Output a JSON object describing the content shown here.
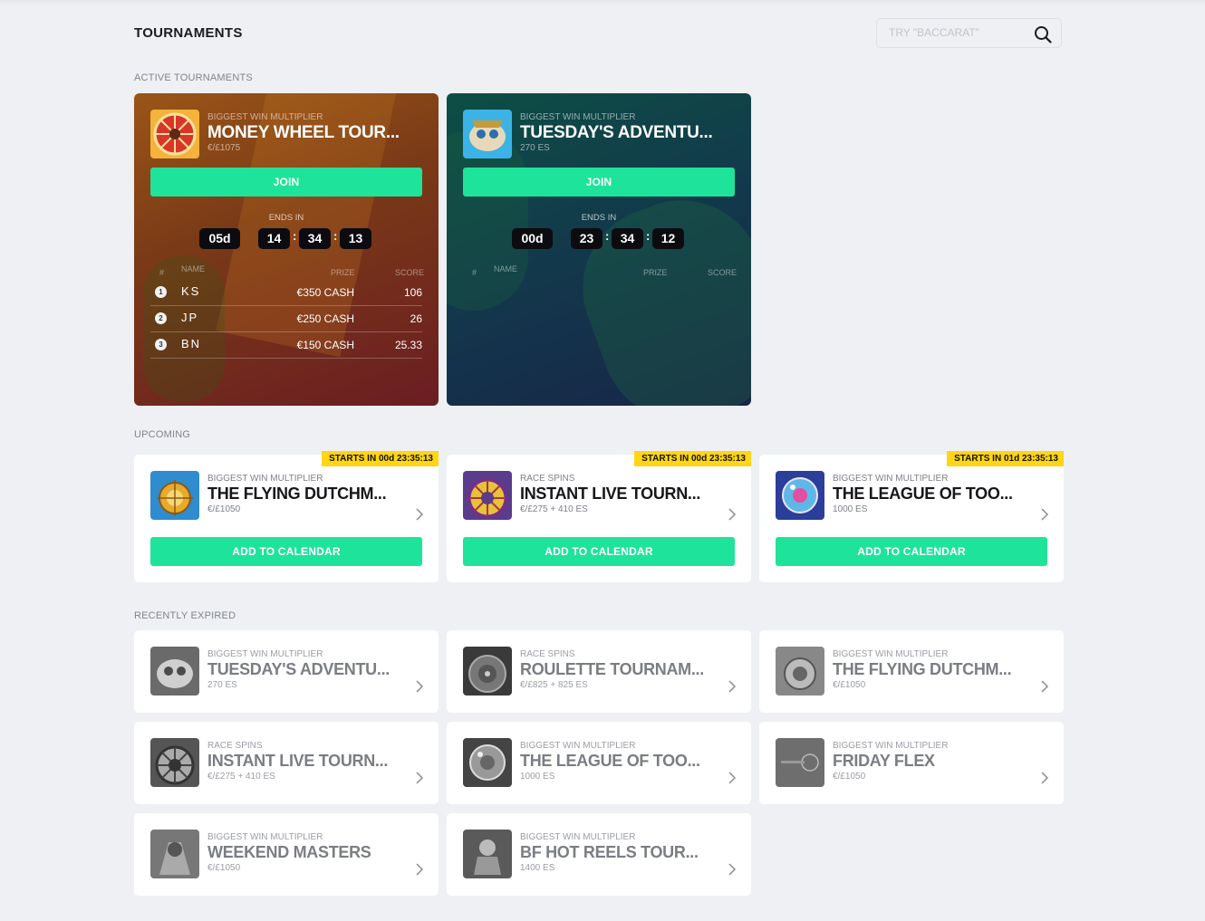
{
  "header": {
    "title": "TOURNAMENTS",
    "search_placeholder": "TRY \"BACCARAT\""
  },
  "sections": {
    "active": "ACTIVE TOURNAMENTS",
    "upcoming": "UPCOMING",
    "expired": "RECENTLY EXPIRED"
  },
  "active": [
    {
      "type": "BIGGEST WIN MULTIPLIER",
      "name": "MONEY WHEEL TOUR...",
      "prize": "€/£1075",
      "join": "JOIN",
      "ends_label": "ENDS IN",
      "timer": {
        "days": "05d",
        "hours": "14",
        "minutes": "34",
        "seconds": "13"
      },
      "headers": {
        "rank": "#",
        "name": "NAME",
        "prize": "PRIZE",
        "score": "SCORE"
      },
      "rows": [
        {
          "rank": "1",
          "name": "KS",
          "prize": "€350 CASH",
          "score": "106"
        },
        {
          "rank": "2",
          "name": "JP",
          "prize": "€250 CASH",
          "score": "26"
        },
        {
          "rank": "3",
          "name": "BN",
          "prize": "€150 CASH",
          "score": "25.33"
        }
      ]
    },
    {
      "type": "BIGGEST WIN MULTIPLIER",
      "name": "TUESDAY'S ADVENTU...",
      "prize": "270 ES",
      "join": "JOIN",
      "ends_label": "ENDS IN",
      "timer": {
        "days": "00d",
        "hours": "23",
        "minutes": "34",
        "seconds": "12"
      },
      "headers": {
        "rank": "#",
        "name": "NAME",
        "prize": "PRIZE",
        "score": "SCORE"
      }
    }
  ],
  "upcoming": [
    {
      "starts": "STARTS IN 00d 23:35:13",
      "type": "BIGGEST WIN MULTIPLIER",
      "name": "THE FLYING DUTCHM...",
      "prize": "€/£1050",
      "button": "ADD TO CALENDAR"
    },
    {
      "starts": "STARTS IN 00d 23:35:13",
      "type": "RACE SPINS",
      "name": "INSTANT LIVE TOURN...",
      "prize": "€/£275 + 410 ES",
      "button": "ADD TO CALENDAR"
    },
    {
      "starts": "STARTS IN 01d 23:35:13",
      "type": "BIGGEST WIN MULTIPLIER",
      "name": "THE LEAGUE OF TOO...",
      "prize": "1000 ES",
      "button": "ADD TO CALENDAR"
    }
  ],
  "expired": [
    {
      "type": "BIGGEST WIN MULTIPLIER",
      "name": "TUESDAY'S ADVENTU...",
      "prize": "270 ES"
    },
    {
      "type": "RACE SPINS",
      "name": "ROULETTE TOURNAM...",
      "prize": "€/£825 + 825 ES"
    },
    {
      "type": "BIGGEST WIN MULTIPLIER",
      "name": "THE FLYING DUTCHM...",
      "prize": "€/£1050"
    },
    {
      "type": "RACE SPINS",
      "name": "INSTANT LIVE TOURN...",
      "prize": "€/£275 + 410 ES"
    },
    {
      "type": "BIGGEST WIN MULTIPLIER",
      "name": "THE LEAGUE OF TOO...",
      "prize": "1000 ES"
    },
    {
      "type": "BIGGEST WIN MULTIPLIER",
      "name": "FRIDAY FLEX",
      "prize": "€/£1050"
    },
    {
      "type": "BIGGEST WIN MULTIPLIER",
      "name": "WEEKEND MASTERS",
      "prize": "€/£1050"
    },
    {
      "type": "BIGGEST WIN MULTIPLIER",
      "name": "BF HOT REELS TOUR...",
      "prize": "1400 ES"
    }
  ],
  "colors": {
    "accent_green": "#1ee39b",
    "badge_yellow": "#ffd515",
    "background": "#eef0f3"
  },
  "icons": [
    "search-icon",
    "chevron-right-icon",
    "game-thumbnail"
  ]
}
